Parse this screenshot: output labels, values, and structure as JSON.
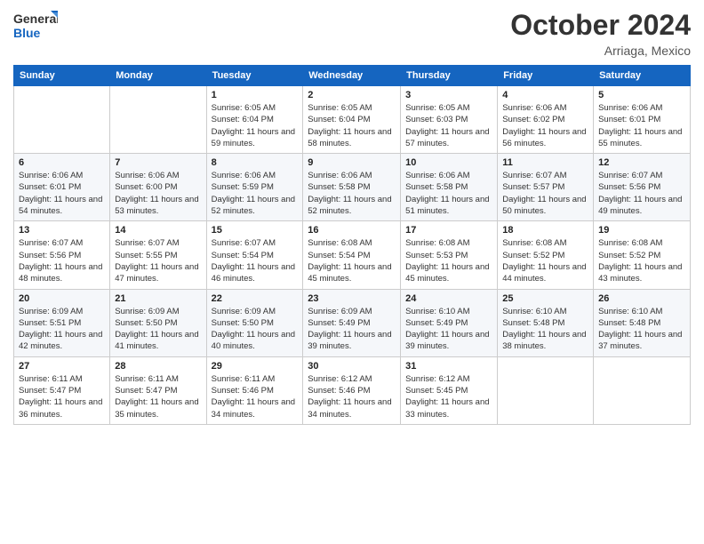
{
  "logo": {
    "line1": "General",
    "line2": "Blue"
  },
  "title": "October 2024",
  "location": "Arriaga, Mexico",
  "days_of_week": [
    "Sunday",
    "Monday",
    "Tuesday",
    "Wednesday",
    "Thursday",
    "Friday",
    "Saturday"
  ],
  "weeks": [
    [
      {
        "day": "",
        "info": ""
      },
      {
        "day": "",
        "info": ""
      },
      {
        "day": "1",
        "info": "Sunrise: 6:05 AM\nSunset: 6:04 PM\nDaylight: 11 hours and 59 minutes."
      },
      {
        "day": "2",
        "info": "Sunrise: 6:05 AM\nSunset: 6:04 PM\nDaylight: 11 hours and 58 minutes."
      },
      {
        "day": "3",
        "info": "Sunrise: 6:05 AM\nSunset: 6:03 PM\nDaylight: 11 hours and 57 minutes."
      },
      {
        "day": "4",
        "info": "Sunrise: 6:06 AM\nSunset: 6:02 PM\nDaylight: 11 hours and 56 minutes."
      },
      {
        "day": "5",
        "info": "Sunrise: 6:06 AM\nSunset: 6:01 PM\nDaylight: 11 hours and 55 minutes."
      }
    ],
    [
      {
        "day": "6",
        "info": "Sunrise: 6:06 AM\nSunset: 6:01 PM\nDaylight: 11 hours and 54 minutes."
      },
      {
        "day": "7",
        "info": "Sunrise: 6:06 AM\nSunset: 6:00 PM\nDaylight: 11 hours and 53 minutes."
      },
      {
        "day": "8",
        "info": "Sunrise: 6:06 AM\nSunset: 5:59 PM\nDaylight: 11 hours and 52 minutes."
      },
      {
        "day": "9",
        "info": "Sunrise: 6:06 AM\nSunset: 5:58 PM\nDaylight: 11 hours and 52 minutes."
      },
      {
        "day": "10",
        "info": "Sunrise: 6:06 AM\nSunset: 5:58 PM\nDaylight: 11 hours and 51 minutes."
      },
      {
        "day": "11",
        "info": "Sunrise: 6:07 AM\nSunset: 5:57 PM\nDaylight: 11 hours and 50 minutes."
      },
      {
        "day": "12",
        "info": "Sunrise: 6:07 AM\nSunset: 5:56 PM\nDaylight: 11 hours and 49 minutes."
      }
    ],
    [
      {
        "day": "13",
        "info": "Sunrise: 6:07 AM\nSunset: 5:56 PM\nDaylight: 11 hours and 48 minutes."
      },
      {
        "day": "14",
        "info": "Sunrise: 6:07 AM\nSunset: 5:55 PM\nDaylight: 11 hours and 47 minutes."
      },
      {
        "day": "15",
        "info": "Sunrise: 6:07 AM\nSunset: 5:54 PM\nDaylight: 11 hours and 46 minutes."
      },
      {
        "day": "16",
        "info": "Sunrise: 6:08 AM\nSunset: 5:54 PM\nDaylight: 11 hours and 45 minutes."
      },
      {
        "day": "17",
        "info": "Sunrise: 6:08 AM\nSunset: 5:53 PM\nDaylight: 11 hours and 45 minutes."
      },
      {
        "day": "18",
        "info": "Sunrise: 6:08 AM\nSunset: 5:52 PM\nDaylight: 11 hours and 44 minutes."
      },
      {
        "day": "19",
        "info": "Sunrise: 6:08 AM\nSunset: 5:52 PM\nDaylight: 11 hours and 43 minutes."
      }
    ],
    [
      {
        "day": "20",
        "info": "Sunrise: 6:09 AM\nSunset: 5:51 PM\nDaylight: 11 hours and 42 minutes."
      },
      {
        "day": "21",
        "info": "Sunrise: 6:09 AM\nSunset: 5:50 PM\nDaylight: 11 hours and 41 minutes."
      },
      {
        "day": "22",
        "info": "Sunrise: 6:09 AM\nSunset: 5:50 PM\nDaylight: 11 hours and 40 minutes."
      },
      {
        "day": "23",
        "info": "Sunrise: 6:09 AM\nSunset: 5:49 PM\nDaylight: 11 hours and 39 minutes."
      },
      {
        "day": "24",
        "info": "Sunrise: 6:10 AM\nSunset: 5:49 PM\nDaylight: 11 hours and 39 minutes."
      },
      {
        "day": "25",
        "info": "Sunrise: 6:10 AM\nSunset: 5:48 PM\nDaylight: 11 hours and 38 minutes."
      },
      {
        "day": "26",
        "info": "Sunrise: 6:10 AM\nSunset: 5:48 PM\nDaylight: 11 hours and 37 minutes."
      }
    ],
    [
      {
        "day": "27",
        "info": "Sunrise: 6:11 AM\nSunset: 5:47 PM\nDaylight: 11 hours and 36 minutes."
      },
      {
        "day": "28",
        "info": "Sunrise: 6:11 AM\nSunset: 5:47 PM\nDaylight: 11 hours and 35 minutes."
      },
      {
        "day": "29",
        "info": "Sunrise: 6:11 AM\nSunset: 5:46 PM\nDaylight: 11 hours and 34 minutes."
      },
      {
        "day": "30",
        "info": "Sunrise: 6:12 AM\nSunset: 5:46 PM\nDaylight: 11 hours and 34 minutes."
      },
      {
        "day": "31",
        "info": "Sunrise: 6:12 AM\nSunset: 5:45 PM\nDaylight: 11 hours and 33 minutes."
      },
      {
        "day": "",
        "info": ""
      },
      {
        "day": "",
        "info": ""
      }
    ]
  ]
}
